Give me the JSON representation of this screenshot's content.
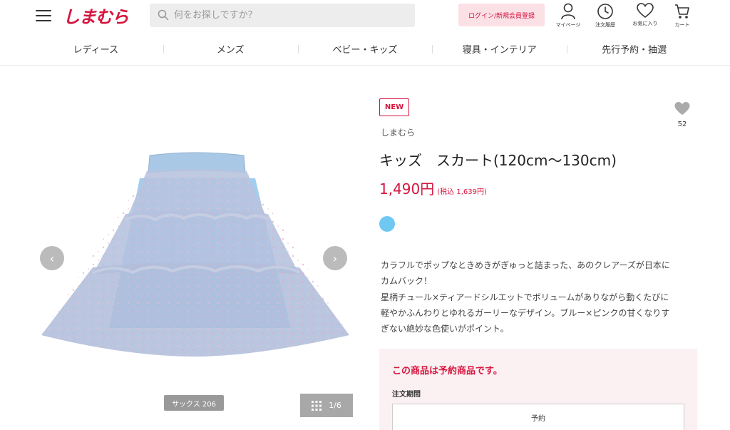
{
  "header": {
    "logo": "しまむら",
    "search_placeholder": "何をお探しですか？",
    "login_label": "ログイン/新規会員登録",
    "icons": [
      {
        "name": "mypage",
        "label": "マイページ"
      },
      {
        "name": "order-history",
        "label": "注文履歴"
      },
      {
        "name": "favorites",
        "label": "お気に入り"
      },
      {
        "name": "cart",
        "label": "カート"
      }
    ]
  },
  "nav": {
    "items": [
      "レディース",
      "メンズ",
      "ベビー・キッズ",
      "寝具・インテリア",
      "先行予約・抽選"
    ]
  },
  "gallery": {
    "color_tag": "サックス 206",
    "page_indicator": "1/6"
  },
  "product": {
    "badge": "NEW",
    "brand": "しまむら",
    "favorite_count": "52",
    "title": "キッズ　スカート(120cm〜130cm)",
    "price": "1,490円",
    "price_tax": "(税込 1,639円)",
    "swatch_color": "#6ec8f2",
    "description": [
      "カラフルでポップなときめきがぎゅっと詰まった、あのクレアーズが日本に",
      "カムバック！",
      "星柄チュール×ティアードシルエットでボリュームがありながら動くたびに",
      "軽やかふんわりとゆれるガーリーなデザイン。ブルー×ピンクの甘くなりす",
      "ぎない絶妙な色使いがポイント。"
    ]
  },
  "reservation": {
    "title": "この商品は予約商品です。",
    "period_label": "注文期間",
    "table_header": "予約"
  },
  "colors": {
    "brand_red": "#d6163f",
    "login_bg": "#fbe0e6",
    "reserve_bg": "#fbf0f2"
  }
}
